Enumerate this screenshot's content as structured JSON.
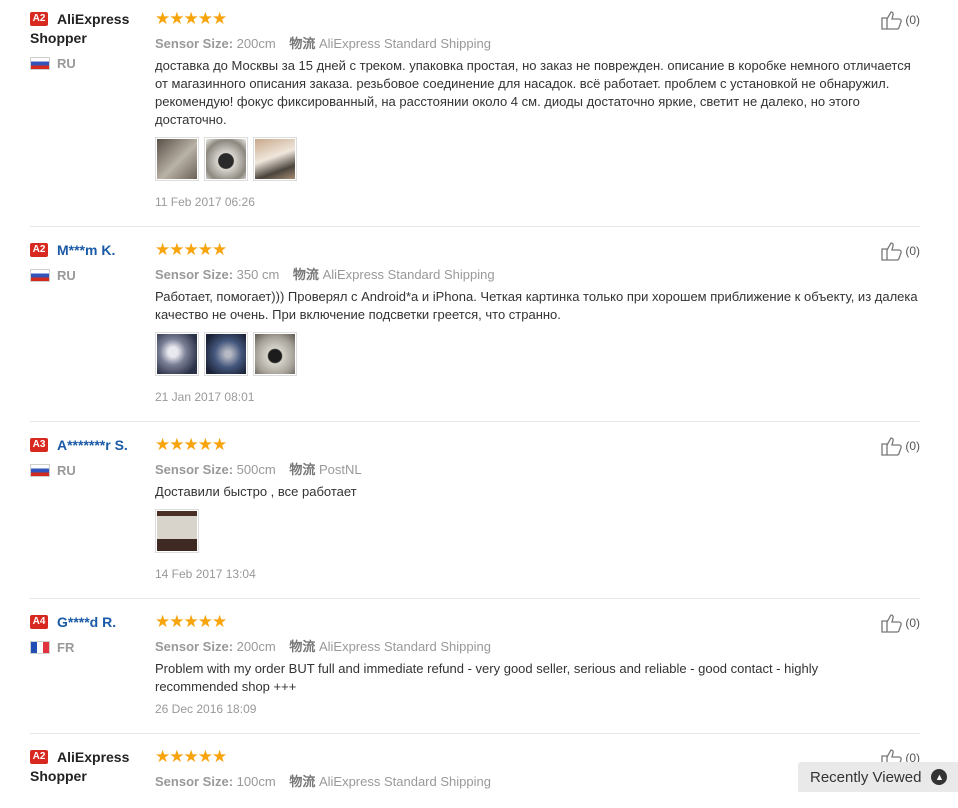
{
  "reviews": [
    {
      "badge": "A2",
      "user": "AliExpress Shopper",
      "country": "RU",
      "stars": "★★★★★",
      "sensor_label": "Sensor Size:",
      "sensor_value": "200cm",
      "ship_label": "物流",
      "ship_value": "AliExpress Standard Shipping",
      "text": "доставка до Москвы за 15 дней с треком. упаковка простая, но заказ не поврежден. описание в коробке немного отличается от магазинного описания заказа. резьбовое соединение для насадок. всё работает. проблем с установкой не обнаружил. рекомендую! фокус фиксированный, на расстоянии около 4 см. диоды достаточно яркие, светит не далеко, но этого достаточно.",
      "date": "11 Feb 2017 06:26",
      "helpful": "(0)"
    },
    {
      "badge": "A2",
      "user": "M***m K.",
      "country": "RU",
      "stars": "★★★★★",
      "sensor_label": "Sensor Size:",
      "sensor_value": "350 cm",
      "ship_label": "物流",
      "ship_value": "AliExpress Standard Shipping",
      "text": "Работает, помогает))) Проверял с Android*а и iPhona. Четкая картинка только при хорошем приближение к объекту, из далека качество не очень. При включение подсветки греется, что странно.",
      "date": "21 Jan 2017 08:01",
      "helpful": "(0)"
    },
    {
      "badge": "A3",
      "user": "A*******r S.",
      "country": "RU",
      "stars": "★★★★★",
      "sensor_label": "Sensor Size:",
      "sensor_value": "500cm",
      "ship_label": "物流",
      "ship_value": "PostNL",
      "text": "Доставили быстро , все работает",
      "date": "14 Feb 2017 13:04",
      "helpful": "(0)"
    },
    {
      "badge": "A4",
      "user": "G****d R.",
      "country": "FR",
      "stars": "★★★★★",
      "sensor_label": "Sensor Size:",
      "sensor_value": "200cm",
      "ship_label": "物流",
      "ship_value": "AliExpress Standard Shipping",
      "text": "Problem with my order BUT full and immediate refund - very good seller, serious and reliable - good contact - highly recommended shop +++",
      "date": "26 Dec 2016 18:09",
      "helpful": "(0)"
    },
    {
      "badge": "A2",
      "user": "AliExpress Shopper",
      "country": "",
      "stars": "★★★★★",
      "sensor_label": "Sensor Size:",
      "sensor_value": "100cm",
      "ship_label": "物流",
      "ship_value": "AliExpress Standard Shipping",
      "helpful": "(0)"
    }
  ],
  "recently_viewed": {
    "label": "Recently Viewed",
    "icon": "chevron-up-icon"
  },
  "colors": {
    "badge": "#d7291f",
    "stars": "#f7a40d",
    "username": "#1a5aa6"
  }
}
